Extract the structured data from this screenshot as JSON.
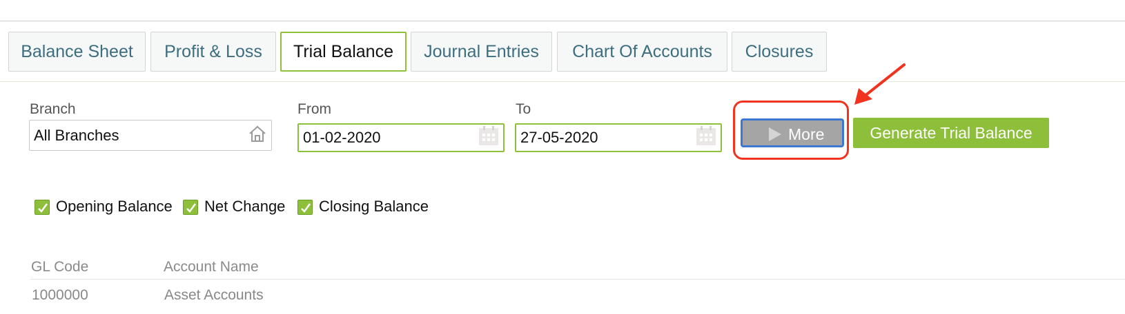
{
  "tabs": [
    {
      "label": "Balance Sheet",
      "active": false
    },
    {
      "label": "Profit & Loss",
      "active": false
    },
    {
      "label": "Trial Balance",
      "active": true
    },
    {
      "label": "Journal Entries",
      "active": false
    },
    {
      "label": "Chart Of Accounts",
      "active": false
    },
    {
      "label": "Closures",
      "active": false
    }
  ],
  "filters": {
    "branch_label": "Branch",
    "branch_value": "All Branches",
    "from_label": "From",
    "from_value": "01-02-2020",
    "to_label": "To",
    "to_value": "27-05-2020"
  },
  "buttons": {
    "more_label": "More",
    "generate_label": "Generate Trial Balance"
  },
  "checkboxes": [
    {
      "label": "Opening Balance",
      "checked": true
    },
    {
      "label": "Net Change",
      "checked": true
    },
    {
      "label": "Closing Balance",
      "checked": true
    }
  ],
  "table": {
    "headers": [
      "GL Code",
      "Account Name"
    ],
    "rows": [
      [
        "1000000",
        "Asset Accounts"
      ]
    ]
  },
  "colors": {
    "accent_green": "#8dbf3a",
    "tab_text": "#3d6e80",
    "annotation_red": "#f1321e",
    "focus_blue": "#3a78d4"
  },
  "icons": {
    "branch": "home-icon",
    "date": "calendar-icon",
    "more": "play-icon",
    "checkbox": "checkmark-icon"
  }
}
